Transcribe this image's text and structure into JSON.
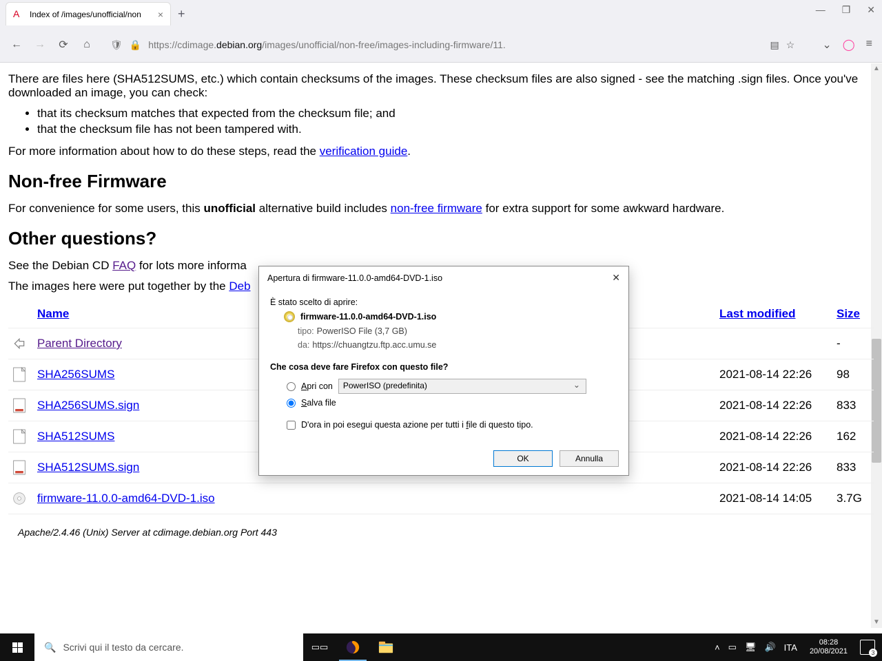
{
  "browser": {
    "tab_title": "Index of /images/unofficial/non",
    "url_pre": "https://cdimage.",
    "url_dark1": "debian.org",
    "url_post1": "/images/unofficial/non-free/images-including-firmware/11.",
    "url_full": "https://cdimage.debian.org/images/unofficial/non-free/images-including-firmware/11."
  },
  "page": {
    "intro_p": "There are files here (SHA512SUMS, etc.) which contain checksums of the images. These checksum files are also signed - see the matching .sign files. Once you've downloaded an image, you can check:",
    "li1": "that its checksum matches that expected from the checksum file; and",
    "li2": "that the checksum file has not been tampered with.",
    "verify_pre": "For more information about how to do these steps, read the ",
    "verify_link": "verification guide",
    "h_nonfree": "Non-free Firmware",
    "nonfree_pre": "For convenience for some users, this ",
    "nonfree_bold": "unofficial",
    "nonfree_mid": " alternative build includes ",
    "nonfree_link": "non-free firmware",
    "nonfree_post": " for extra support for some awkward hardware.",
    "h_otherq": "Other questions?",
    "faq_pre": "See the Debian CD ",
    "faq_link": "FAQ",
    "faq_post": " for lots more informa",
    "debcd_pre": "The images here were put together by the ",
    "debcd_link": "Deb",
    "th_name": "Name",
    "th_lastmod": "Last modified",
    "th_size": "Size",
    "rows": [
      {
        "name": "Parent Directory",
        "lastmod": "",
        "size": "-",
        "visited": true
      },
      {
        "name": "SHA256SUMS",
        "lastmod": "2021-08-14 22:26",
        "size": "98"
      },
      {
        "name": "SHA256SUMS.sign",
        "lastmod": "2021-08-14 22:26",
        "size": "833"
      },
      {
        "name": "SHA512SUMS",
        "lastmod": "2021-08-14 22:26",
        "size": "162"
      },
      {
        "name": "SHA512SUMS.sign",
        "lastmod": "2021-08-14 22:26",
        "size": "833"
      },
      {
        "name": "firmware-11.0.0-amd64-DVD-1.iso",
        "lastmod": "2021-08-14 14:05",
        "size": "3.7G"
      }
    ],
    "server_sig": "Apache/2.4.46 (Unix) Server at cdimage.debian.org Port 443"
  },
  "dialog": {
    "title": "Apertura di firmware-11.0.0-amd64-DVD-1.iso",
    "chosen": "È stato scelto di aprire:",
    "filename": "firmware-11.0.0-amd64-DVD-1.iso",
    "tipo_k": "tipo:",
    "tipo_v": "PowerISO File (3,7 GB)",
    "da_k": "da:",
    "da_v": "https://chuangtzu.ftp.acc.umu.se",
    "question": "Che cosa deve fare Firefox con questo file?",
    "open_with_pre": "A",
    "open_with_post": "pri con",
    "open_app": "PowerISO (predefinita)",
    "save_pre": "S",
    "save_post": "alva file",
    "always_pre": "D'ora in poi esegui questa azione per tutti i ",
    "always_under": "f",
    "always_post": "ile di questo tipo.",
    "ok": "OK",
    "cancel": "Annulla"
  },
  "taskbar": {
    "search_placeholder": "Scrivi qui il testo da cercare.",
    "lang": "ITA",
    "time": "08:28",
    "date": "20/08/2021",
    "notif_count": "3"
  }
}
